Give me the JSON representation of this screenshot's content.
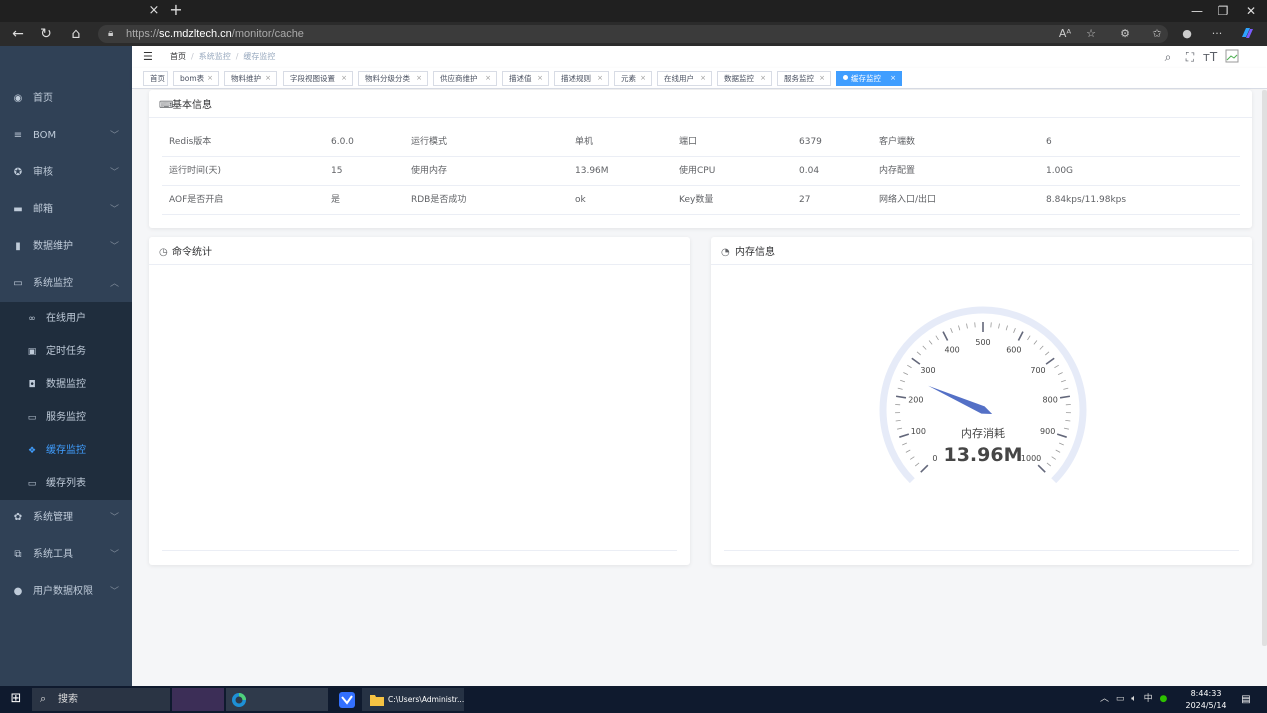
{
  "browser": {
    "url_prefix": "https://",
    "url_host": "sc.mdzltech.cn",
    "url_path": "/monitor/cache",
    "tab_close": "×",
    "tab_new": "+"
  },
  "sidebar": {
    "items": [
      {
        "label": "首页"
      },
      {
        "label": "BOM"
      },
      {
        "label": "审核"
      },
      {
        "label": "邮箱"
      },
      {
        "label": "数据维护"
      },
      {
        "label": "系统监控"
      },
      {
        "label": "系统管理"
      },
      {
        "label": "系统工具"
      },
      {
        "label": "用户数据权限"
      }
    ],
    "subitems": [
      {
        "label": "在线用户"
      },
      {
        "label": "定时任务"
      },
      {
        "label": "数据监控"
      },
      {
        "label": "服务监控"
      },
      {
        "label": "缓存监控"
      },
      {
        "label": "缓存列表"
      }
    ]
  },
  "breadcrumb": {
    "home": "首页",
    "sep": "/",
    "parent": "系统监控",
    "current": "缓存监控"
  },
  "tags": [
    {
      "label": "首页"
    },
    {
      "label": "bom表"
    },
    {
      "label": "物料维护"
    },
    {
      "label": "字段视图设置"
    },
    {
      "label": "物料分级分类"
    },
    {
      "label": "供应商维护"
    },
    {
      "label": "描述值"
    },
    {
      "label": "描述规则"
    },
    {
      "label": "元素"
    },
    {
      "label": "在线用户"
    },
    {
      "label": "数据监控"
    },
    {
      "label": "服务监控"
    },
    {
      "label": "缓存监控"
    }
  ],
  "tag_close": "×",
  "basic_info": {
    "title": "基本信息",
    "rows": [
      [
        [
          "Redis版本",
          "6.0.0"
        ],
        [
          "运行模式",
          "单机"
        ],
        [
          "端口",
          "6379"
        ],
        [
          "客户端数",
          "6"
        ]
      ],
      [
        [
          "运行时间(天)",
          "15"
        ],
        [
          "使用内存",
          "13.96M"
        ],
        [
          "使用CPU",
          "0.04"
        ],
        [
          "内存配置",
          "1.00G"
        ]
      ],
      [
        [
          "AOF是否开启",
          "是"
        ],
        [
          "RDB是否成功",
          "ok"
        ],
        [
          "Key数量",
          "27"
        ],
        [
          "网络入口/出口",
          "8.84kps/11.98kps"
        ]
      ]
    ]
  },
  "command_stats": {
    "title": "命令统计"
  },
  "memory_info": {
    "title": "内存信息",
    "gauge": {
      "min": 0,
      "max": 1000,
      "value": 255,
      "ticks": [
        "0",
        "100",
        "200",
        "300",
        "400",
        "500",
        "600",
        "700",
        "800",
        "900",
        "1000"
      ],
      "label": "内存消耗",
      "display": "13.96M",
      "color": "#5470c6"
    }
  },
  "taskbar": {
    "search_label": "搜索",
    "explorer_label": "C:\\Users\\Administr...",
    "tray_ime": "中",
    "clock_time": "8:44:33",
    "clock_date": "2024/5/14"
  }
}
